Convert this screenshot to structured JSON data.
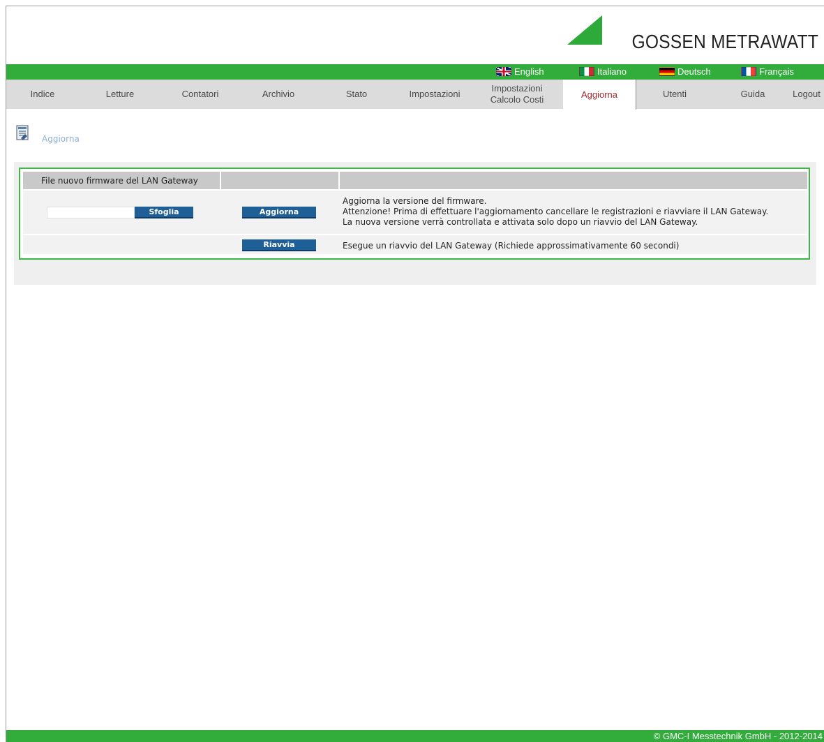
{
  "brand": {
    "name": "GOSSEN METRAWATT",
    "accent": "#32ad3c"
  },
  "languages": [
    {
      "label": "English",
      "flag": "uk-flag-icon"
    },
    {
      "label": "Italiano",
      "flag": "italy-flag-icon"
    },
    {
      "label": "Deutsch",
      "flag": "germany-flag-icon"
    },
    {
      "label": "Français",
      "flag": "france-flag-icon"
    }
  ],
  "nav": {
    "tabs": [
      {
        "label": "Indice"
      },
      {
        "label": "Letture"
      },
      {
        "label": "Contatori"
      },
      {
        "label": "Archivio"
      },
      {
        "label": "Stato"
      },
      {
        "label": "Impostazioni"
      },
      {
        "label_line1": "Impostazioni",
        "label_line2": "Calcolo Costi"
      },
      {
        "label": "Aggiorna",
        "active": true
      },
      {
        "label": "Utenti"
      },
      {
        "label": "Guida"
      },
      {
        "label": "Logout"
      }
    ]
  },
  "page": {
    "title": "Aggiorna",
    "icon": "update-page-icon"
  },
  "panel": {
    "header_col1": "File nuovo firmware del LAN Gateway",
    "file_input_value": "",
    "browse_label": "Sfoglia",
    "update_label": "Aggiorna",
    "restart_label": "Riavvia",
    "update_desc": [
      "Aggiorna la versione del firmware.",
      "Attenzione! Prima di effettuare l'aggiornamento cancellare le registrazioni e riavviare il LAN Gateway.",
      "La nuova versione verrà controllata e attivata solo dopo un riavvio del LAN Gateway."
    ],
    "restart_desc": "Esegue un riavvio del LAN Gateway (Richiede approssimativamente 60 secondi)"
  },
  "footer": {
    "copyright": "© GMC-I Messtechnik GmbH - 2012-2014"
  }
}
